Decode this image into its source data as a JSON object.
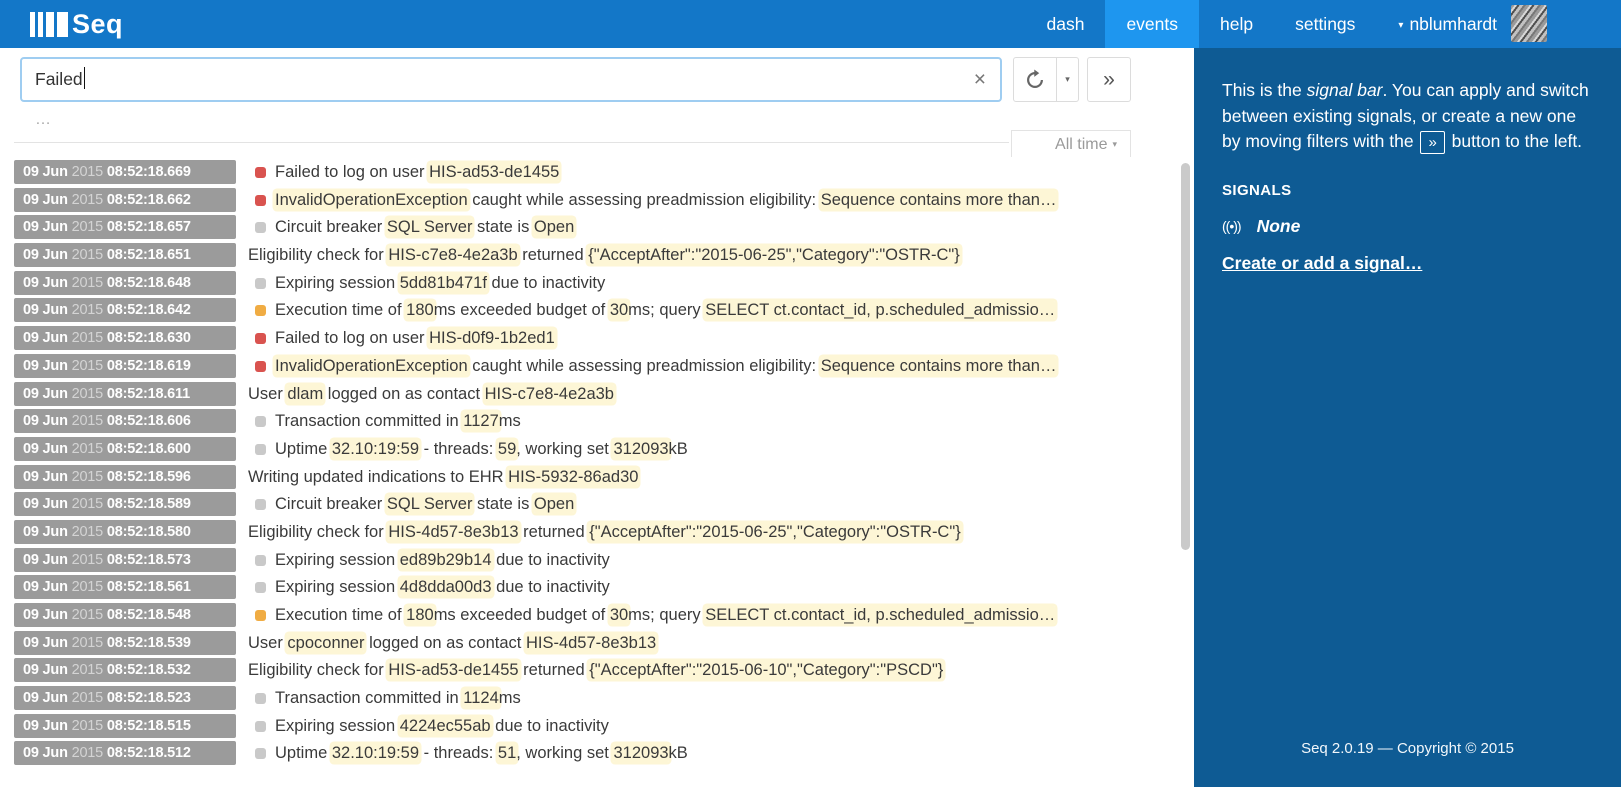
{
  "topbar": {
    "brand": "Seq",
    "nav": [
      {
        "label": "dash",
        "active": false
      },
      {
        "label": "events",
        "active": true
      },
      {
        "label": "help",
        "active": false
      },
      {
        "label": "settings",
        "active": false
      }
    ],
    "user_caret": "▾",
    "user": "nblumhardt"
  },
  "search": {
    "value": "Failed",
    "clear_icon": "×",
    "refresh_caret": "▾",
    "forward_icon": "»"
  },
  "toolbar": {
    "ellipsis": "…",
    "range_label": "All time",
    "range_caret": "▾"
  },
  "events": [
    {
      "date": "09 Jun",
      "year": "2015",
      "time": "08:52:18.669",
      "level": "error",
      "parts": [
        [
          "Failed to log on user ",
          0
        ],
        [
          "HIS-ad53-de1455",
          1
        ]
      ]
    },
    {
      "date": "09 Jun",
      "year": "2015",
      "time": "08:52:18.662",
      "level": "error",
      "parts": [
        [
          "InvalidOperationException",
          1
        ],
        [
          " caught while assessing preadmission eligibility: ",
          0
        ],
        [
          "Sequence contains more than…",
          1
        ]
      ]
    },
    {
      "date": "09 Jun",
      "year": "2015",
      "time": "08:52:18.657",
      "level": "debug",
      "parts": [
        [
          "Circuit breaker ",
          0
        ],
        [
          "SQL Server",
          1
        ],
        [
          " state is ",
          0
        ],
        [
          "Open",
          1
        ]
      ]
    },
    {
      "date": "09 Jun",
      "year": "2015",
      "time": "08:52:18.651",
      "level": "info",
      "parts": [
        [
          "Eligibility check for ",
          0
        ],
        [
          "HIS-c7e8-4e2a3b",
          1
        ],
        [
          " returned ",
          0
        ],
        [
          "{\"AcceptAfter\":\"2015-06-25\",\"Category\":\"OSTR-C\"}",
          1
        ]
      ]
    },
    {
      "date": "09 Jun",
      "year": "2015",
      "time": "08:52:18.648",
      "level": "debug",
      "parts": [
        [
          "Expiring session ",
          0
        ],
        [
          "5dd81b471f",
          1
        ],
        [
          " due to inactivity",
          0
        ]
      ]
    },
    {
      "date": "09 Jun",
      "year": "2015",
      "time": "08:52:18.642",
      "level": "warning",
      "parts": [
        [
          "Execution time of ",
          0
        ],
        [
          "180",
          1
        ],
        [
          "ms exceeded budget of ",
          0
        ],
        [
          "30",
          1
        ],
        [
          "ms; query ",
          0
        ],
        [
          "SELECT ct.contact_id, p.scheduled_admissio…",
          1
        ]
      ]
    },
    {
      "date": "09 Jun",
      "year": "2015",
      "time": "08:52:18.630",
      "level": "error",
      "parts": [
        [
          "Failed to log on user ",
          0
        ],
        [
          "HIS-d0f9-1b2ed1",
          1
        ]
      ]
    },
    {
      "date": "09 Jun",
      "year": "2015",
      "time": "08:52:18.619",
      "level": "error",
      "parts": [
        [
          "InvalidOperationException",
          1
        ],
        [
          " caught while assessing preadmission eligibility: ",
          0
        ],
        [
          "Sequence contains more than…",
          1
        ]
      ]
    },
    {
      "date": "09 Jun",
      "year": "2015",
      "time": "08:52:18.611",
      "level": "info",
      "parts": [
        [
          "User ",
          0
        ],
        [
          "dlam",
          1
        ],
        [
          " logged on as contact ",
          0
        ],
        [
          "HIS-c7e8-4e2a3b",
          1
        ]
      ]
    },
    {
      "date": "09 Jun",
      "year": "2015",
      "time": "08:52:18.606",
      "level": "debug",
      "parts": [
        [
          "Transaction committed in ",
          0
        ],
        [
          "1127",
          1
        ],
        [
          "ms",
          0
        ]
      ]
    },
    {
      "date": "09 Jun",
      "year": "2015",
      "time": "08:52:18.600",
      "level": "debug",
      "parts": [
        [
          "Uptime ",
          0
        ],
        [
          "32.10:19:59",
          1
        ],
        [
          " - threads: ",
          0
        ],
        [
          "59",
          1
        ],
        [
          ", working set ",
          0
        ],
        [
          "312093",
          1
        ],
        [
          "kB",
          0
        ]
      ]
    },
    {
      "date": "09 Jun",
      "year": "2015",
      "time": "08:52:18.596",
      "level": "info",
      "parts": [
        [
          "Writing updated indications to EHR ",
          0
        ],
        [
          "HIS-5932-86ad30",
          1
        ]
      ]
    },
    {
      "date": "09 Jun",
      "year": "2015",
      "time": "08:52:18.589",
      "level": "debug",
      "parts": [
        [
          "Circuit breaker ",
          0
        ],
        [
          "SQL Server",
          1
        ],
        [
          " state is ",
          0
        ],
        [
          "Open",
          1
        ]
      ]
    },
    {
      "date": "09 Jun",
      "year": "2015",
      "time": "08:52:18.580",
      "level": "info",
      "parts": [
        [
          "Eligibility check for ",
          0
        ],
        [
          "HIS-4d57-8e3b13",
          1
        ],
        [
          " returned ",
          0
        ],
        [
          "{\"AcceptAfter\":\"2015-06-25\",\"Category\":\"OSTR-C\"}",
          1
        ]
      ]
    },
    {
      "date": "09 Jun",
      "year": "2015",
      "time": "08:52:18.573",
      "level": "debug",
      "parts": [
        [
          "Expiring session ",
          0
        ],
        [
          "ed89b29b14",
          1
        ],
        [
          " due to inactivity",
          0
        ]
      ]
    },
    {
      "date": "09 Jun",
      "year": "2015",
      "time": "08:52:18.561",
      "level": "debug",
      "parts": [
        [
          "Expiring session ",
          0
        ],
        [
          "4d8dda00d3",
          1
        ],
        [
          " due to inactivity",
          0
        ]
      ]
    },
    {
      "date": "09 Jun",
      "year": "2015",
      "time": "08:52:18.548",
      "level": "warning",
      "parts": [
        [
          "Execution time of ",
          0
        ],
        [
          "180",
          1
        ],
        [
          "ms exceeded budget of ",
          0
        ],
        [
          "30",
          1
        ],
        [
          "ms; query ",
          0
        ],
        [
          "SELECT ct.contact_id, p.scheduled_admissio…",
          1
        ]
      ]
    },
    {
      "date": "09 Jun",
      "year": "2015",
      "time": "08:52:18.539",
      "level": "info",
      "parts": [
        [
          "User ",
          0
        ],
        [
          "cpoconner",
          1
        ],
        [
          " logged on as contact ",
          0
        ],
        [
          "HIS-4d57-8e3b13",
          1
        ]
      ]
    },
    {
      "date": "09 Jun",
      "year": "2015",
      "time": "08:52:18.532",
      "level": "info",
      "parts": [
        [
          "Eligibility check for ",
          0
        ],
        [
          "HIS-ad53-de1455",
          1
        ],
        [
          " returned ",
          0
        ],
        [
          "{\"AcceptAfter\":\"2015-06-10\",\"Category\":\"PSCD\"}",
          1
        ]
      ]
    },
    {
      "date": "09 Jun",
      "year": "2015",
      "time": "08:52:18.523",
      "level": "debug",
      "parts": [
        [
          "Transaction committed in ",
          0
        ],
        [
          "1124",
          1
        ],
        [
          "ms",
          0
        ]
      ]
    },
    {
      "date": "09 Jun",
      "year": "2015",
      "time": "08:52:18.515",
      "level": "debug",
      "parts": [
        [
          "Expiring session ",
          0
        ],
        [
          "4224ec55ab",
          1
        ],
        [
          " due to inactivity",
          0
        ]
      ]
    },
    {
      "date": "09 Jun",
      "year": "2015",
      "time": "08:52:18.512",
      "level": "debug",
      "parts": [
        [
          "Uptime ",
          0
        ],
        [
          "32.10:19:59",
          1
        ],
        [
          " - threads: ",
          0
        ],
        [
          "51",
          1
        ],
        [
          ", working set ",
          0
        ],
        [
          "312093",
          1
        ],
        [
          "kB",
          0
        ]
      ]
    }
  ],
  "sidebar": {
    "intro": {
      "pre": "This is the ",
      "italic": "signal bar",
      "mid": ". You can apply and switch between existing signals, or create a new one by moving filters with the ",
      "button": "»",
      "post": " button to the left."
    },
    "signals_heading": "SIGNALS",
    "signal_icon": "((•))",
    "signal_none": "None",
    "create_link": "Create or add a signal…",
    "footer": "Seq 2.0.19 — Copyright © 2015"
  },
  "colors": {
    "topbar_blue": "#1377c8",
    "active_tab_blue": "#1e96ef",
    "sidebar_blue": "#0e5b94",
    "badge_gray": "#9b9b9b",
    "error_red": "#d9534f",
    "warning_orange": "#f0ac43",
    "debug_gray": "#c9c9c9",
    "highlight_yellow": "#fdf6d6"
  }
}
